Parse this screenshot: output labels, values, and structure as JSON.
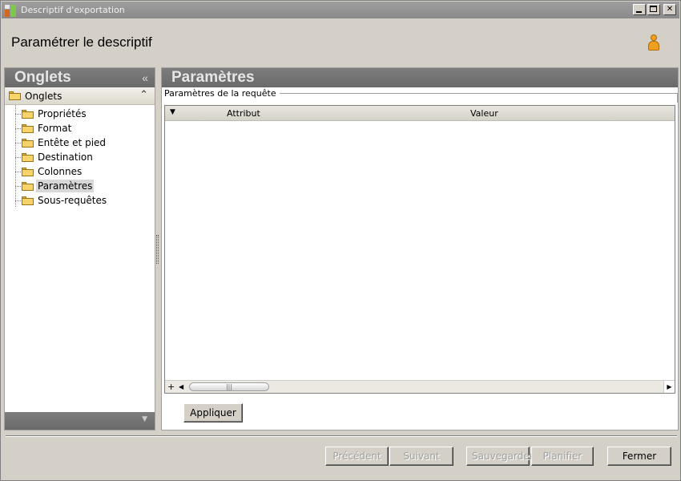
{
  "window": {
    "title": "Descriptif d'exportation"
  },
  "header": {
    "title": "Paramétrer le descriptif"
  },
  "left": {
    "panel_title": "Onglets",
    "collapse_glyph": "«",
    "group_label": "Onglets",
    "group_toggle_glyph": "⌃",
    "items": [
      {
        "label": "Propriétés"
      },
      {
        "label": "Format"
      },
      {
        "label": "Entête et pied"
      },
      {
        "label": "Destination"
      },
      {
        "label": "Colonnes"
      },
      {
        "label": "Paramètres",
        "selected": true
      },
      {
        "label": "Sous-requêtes"
      }
    ]
  },
  "right": {
    "panel_title": "Paramètres",
    "section_title": "Paramètres de la requête",
    "grid": {
      "columns": [
        "Attribut",
        "Valeur"
      ]
    },
    "apply_label": "Appliquer"
  },
  "footer": {
    "buttons": [
      {
        "label": "Précédent",
        "enabled": false
      },
      {
        "label": "Suivant",
        "enabled": false
      },
      {
        "label": "Sauvegarder",
        "enabled": false
      },
      {
        "label": "Planifier",
        "enabled": false
      },
      {
        "label": "Fermer",
        "enabled": true
      }
    ]
  }
}
